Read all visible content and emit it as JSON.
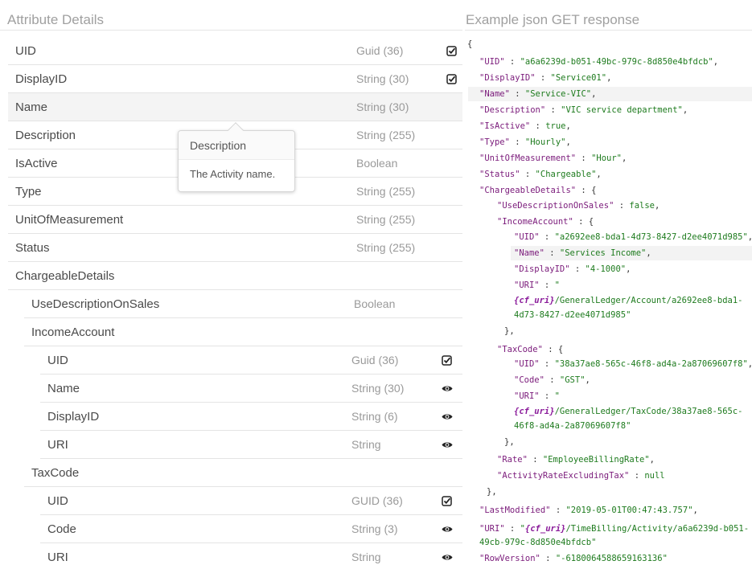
{
  "left": {
    "title": "Attribute Details",
    "rows": [
      {
        "name": "UID",
        "type": "Guid (36)",
        "icon": "required-check-icon"
      },
      {
        "name": "DisplayID",
        "type": "String (30)",
        "icon": "required-check-icon"
      },
      {
        "name": "Name",
        "type": "String (30)",
        "icon": ""
      },
      {
        "name": "Description",
        "type": "String (255)",
        "icon": ""
      },
      {
        "name": "IsActive",
        "type": "Boolean",
        "icon": ""
      },
      {
        "name": "Type",
        "type": "String (255)",
        "icon": ""
      },
      {
        "name": "UnitOfMeasurement",
        "type": "String (255)",
        "icon": ""
      },
      {
        "name": "Status",
        "type": "String (255)",
        "icon": ""
      },
      {
        "name": "ChargeableDetails",
        "type": "",
        "icon": ""
      },
      {
        "name": "UseDescriptionOnSales",
        "type": "Boolean",
        "icon": ""
      },
      {
        "name": "IncomeAccount",
        "type": "",
        "icon": ""
      },
      {
        "name": "UID",
        "type": "Guid (36)",
        "icon": "required-check-icon"
      },
      {
        "name": "Name",
        "type": "String (30)",
        "icon": "read-only-eye-icon"
      },
      {
        "name": "DisplayID",
        "type": "String (6)",
        "icon": "read-only-eye-icon"
      },
      {
        "name": "URI",
        "type": "String",
        "icon": "read-only-eye-icon"
      },
      {
        "name": "TaxCode",
        "type": "",
        "icon": ""
      },
      {
        "name": "UID",
        "type": "GUID (36)",
        "icon": "required-check-icon"
      },
      {
        "name": "Code",
        "type": "String (3)",
        "icon": "read-only-eye-icon"
      },
      {
        "name": "URI",
        "type": "String",
        "icon": "read-only-eye-icon"
      }
    ],
    "tooltip": {
      "title": "Description",
      "text": "The Activity name."
    }
  },
  "right": {
    "title": "Example json GET response",
    "code": {
      "open_brace": "{",
      "uid_key": "\"UID\"",
      "uid_val": "\"a6a6239d-b051-49bc-979c-8d850e4bfdcb\"",
      "displayid_key": "\"DisplayID\"",
      "displayid_val": "\"Service01\"",
      "name_key": "\"Name\"",
      "name_val": "\"Service-VIC\"",
      "description_key": "\"Description\"",
      "description_val": "\"VIC service department\"",
      "isactive_key": "\"IsActive\"",
      "isactive_val": "true",
      "type_key": "\"Type\"",
      "type_val": "\"Hourly\"",
      "uom_key": "\"UnitOfMeasurement\"",
      "uom_val": "\"Hour\"",
      "status_key": "\"Status\"",
      "status_val": "\"Chargeable\"",
      "cd_key": "\"ChargeableDetails\"",
      "udos_key": "\"UseDescriptionOnSales\"",
      "udos_val": "false",
      "ia_key": "\"IncomeAccount\"",
      "ia_uid_key": "\"UID\"",
      "ia_uid_val": "\"a2692ee8-bda1-4d73-8427-d2ee4071d985\"",
      "ia_name_key": "\"Name\"",
      "ia_name_val": "\"Services Income\"",
      "ia_did_key": "\"DisplayID\"",
      "ia_did_val": "\"4-1000\"",
      "ia_uri_key": "\"URI\"",
      "ia_uri_quote": "\"",
      "cf_uri": "{cf_uri}",
      "ia_uri_rest1": "/GeneralLedger/Account/a2692ee8-bda1-",
      "ia_uri_rest2": "4d73-8427-d2ee4071d985\"",
      "tc_key": "\"TaxCode\"",
      "tc_uid_key": "\"UID\"",
      "tc_uid_val": "\"38a37ae8-565c-46f8-ad4a-2a87069607f8\"",
      "tc_code_key": "\"Code\"",
      "tc_code_val": "\"GST\"",
      "tc_uri_key": "\"URI\"",
      "tc_uri_quote": "\"",
      "tc_uri_rest1": "/GeneralLedger/TaxCode/38a37ae8-565c-",
      "tc_uri_rest2": "46f8-ad4a-2a87069607f8\"",
      "rate_key": "\"Rate\"",
      "rate_val": "\"EmployeeBillingRate\"",
      "are_key": "\"ActivityRateExcludingTax\"",
      "are_val": "null",
      "lm_key": "\"LastModified\"",
      "lm_val": "\"2019-05-01T00:47:43.757\"",
      "uri_key": "\"URI\"",
      "uri_quote": "\"",
      "uri_rest1": "/TimeBilling/Activity/a6a6239d-b051-",
      "uri_rest2": "49cb-979c-8d850e4bfdcb\"",
      "rv_key": "\"RowVersion\"",
      "rv_val": "\"-6180064588659163136\""
    }
  }
}
